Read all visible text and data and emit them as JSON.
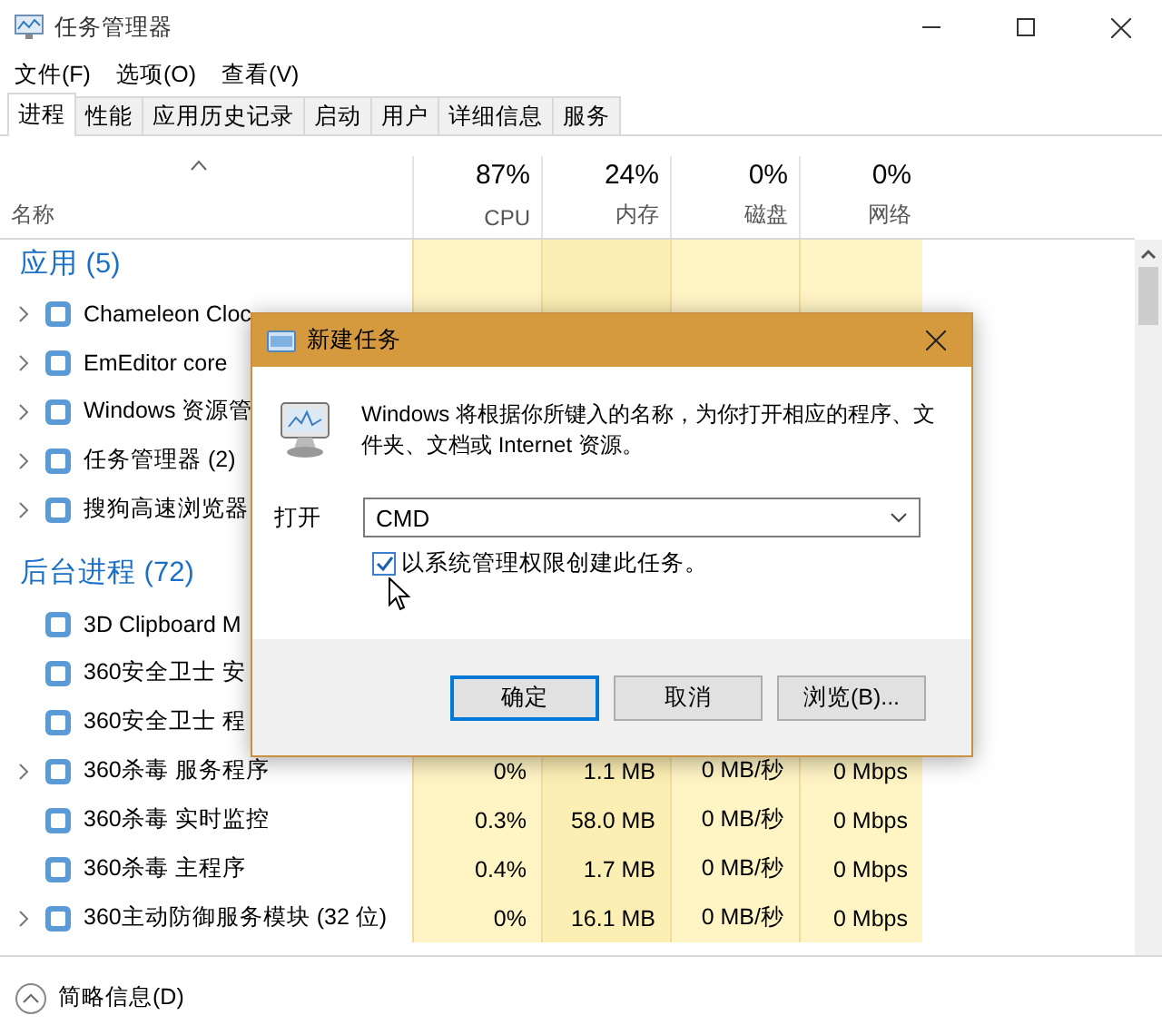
{
  "window": {
    "title": "任务管理器"
  },
  "menu": [
    "文件(F)",
    "选项(O)",
    "查看(V)"
  ],
  "tabs": [
    {
      "label": "进程",
      "selected": true
    },
    {
      "label": "性能",
      "selected": false
    },
    {
      "label": "应用历史记录",
      "selected": false
    },
    {
      "label": "启动",
      "selected": false
    },
    {
      "label": "用户",
      "selected": false
    },
    {
      "label": "详细信息",
      "selected": false
    },
    {
      "label": "服务",
      "selected": false
    }
  ],
  "table": {
    "columns": [
      {
        "label": "名称"
      },
      {
        "usage": "87%",
        "label": "CPU"
      },
      {
        "usage": "24%",
        "label": "内存"
      },
      {
        "usage": "0%",
        "label": "磁盘"
      },
      {
        "usage": "0%",
        "label": "网络"
      }
    ],
    "rows": [
      {
        "kind": "group",
        "name": "应用 (5)"
      },
      {
        "kind": "process",
        "name": "Chameleon Cloc",
        "expandable": true
      },
      {
        "kind": "process",
        "name": "EmEditor core",
        "expandable": true
      },
      {
        "kind": "process",
        "name": "Windows 资源管",
        "expandable": true
      },
      {
        "kind": "process",
        "name": "任务管理器 (2)",
        "expandable": true
      },
      {
        "kind": "process",
        "name": "搜狗高速浏览器",
        "expandable": true
      },
      {
        "kind": "group",
        "name": "后台进程 (72)"
      },
      {
        "kind": "process",
        "name": "3D Clipboard M",
        "expandable": false
      },
      {
        "kind": "process",
        "name": "360安全卫士 安",
        "expandable": false
      },
      {
        "kind": "process",
        "name": "360安全卫士 程",
        "expandable": false
      },
      {
        "kind": "process",
        "name": "360杀毒 服务程序",
        "expandable": true,
        "cells": [
          "0%",
          "1.1 MB",
          "0 MB/秒",
          "0 Mbps"
        ]
      },
      {
        "kind": "process",
        "name": "360杀毒 实时监控",
        "expandable": false,
        "cells": [
          "0.3%",
          "58.0 MB",
          "0 MB/秒",
          "0 Mbps"
        ]
      },
      {
        "kind": "process",
        "name": "360杀毒 主程序",
        "expandable": false,
        "cells": [
          "0.4%",
          "1.7 MB",
          "0 MB/秒",
          "0 Mbps"
        ]
      },
      {
        "kind": "process",
        "name": "360主动防御服务模块 (32 位)",
        "expandable": true,
        "cells": [
          "0%",
          "16.1 MB",
          "0 MB/秒",
          "0 Mbps"
        ]
      }
    ]
  },
  "footer": {
    "label": "简略信息(D)"
  },
  "dialog": {
    "title": "新建任务",
    "message": "Windows 将根据你所键入的名称，为你打开相应的程序、文件夹、文档或 Internet 资源。",
    "open_label": "打开",
    "value": "CMD",
    "admin_checkbox": {
      "label": "以系统管理权限创建此任务。",
      "checked": true
    },
    "buttons": [
      {
        "label": "确定",
        "default": true
      },
      {
        "label": "取消",
        "default": false
      },
      {
        "label": "浏览(B)...",
        "default": false
      }
    ]
  }
}
